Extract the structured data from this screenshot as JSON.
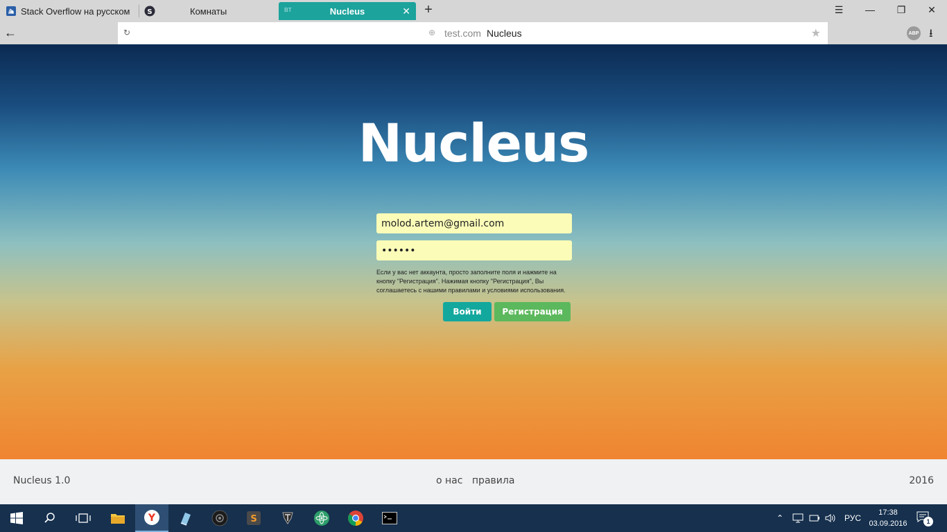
{
  "browser": {
    "tabs": [
      {
        "label": "Stack Overflow на русском",
        "icon": "stackoverflow-icon"
      },
      {
        "label": "Комнаты",
        "icon": "s-chat-icon"
      },
      {
        "label": "Nucleus",
        "icon": "vt-icon",
        "badge": "BT",
        "active": true
      }
    ],
    "new_tab_symbol": "+",
    "window_controls": {
      "menu": "☰",
      "minimize": "—",
      "restore": "❐",
      "close": "✕"
    },
    "address": {
      "domain": "test.com",
      "page_title": "Nucleus"
    },
    "extensions": {
      "adblock_label": "ABP"
    },
    "accent_color": "#1ba39c"
  },
  "page": {
    "brand_title": "Nucleus",
    "login": {
      "email_value": "molod.artem@gmail.com",
      "password_value": "••••••",
      "hint": "Если у вас нет аккаунта, просто заполните поля и нажмите на кнопку \"Регистрация\". Нажимая кнопку \"Регистрация\", Вы соглашаетесь с нашими правилами и условиями использования.",
      "login_button": "Войти",
      "register_button": "Регистрация",
      "login_color": "#13a89e",
      "register_color": "#5cb85c",
      "field_color": "#fafcb8"
    },
    "footer": {
      "version": "Nucleus 1.0",
      "links": [
        "о нас",
        "правила"
      ],
      "year": "2016"
    }
  },
  "taskbar": {
    "apps": [
      "windows-start-icon",
      "search-icon",
      "task-view-icon",
      "file-explorer-icon",
      "yandex-browser-icon",
      "notepad-icon",
      "steam-icon",
      "sublime-text-icon",
      "world-of-tanks-icon",
      "atom-icon",
      "chrome-icon",
      "terminal-icon"
    ],
    "language": "РУС",
    "time": "17:38",
    "date": "03.09.2016",
    "notifications_count": "1"
  }
}
